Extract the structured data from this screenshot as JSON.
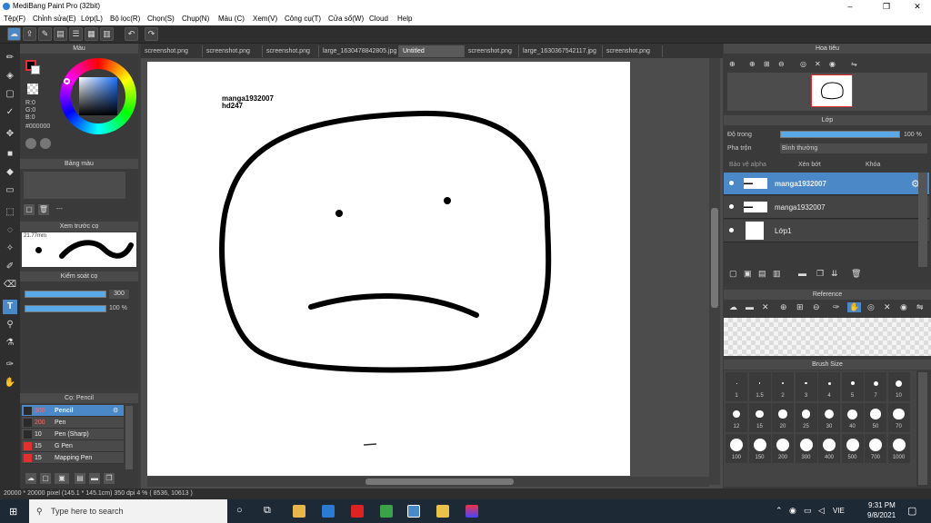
{
  "window": {
    "title": "MediBang Paint Pro (32bit)",
    "minimize": "–",
    "maximize": "❐",
    "close": "✕"
  },
  "menu": [
    "Tệp(F)",
    "Chỉnh sửa(E)",
    "Lớp(L)",
    "Bộ lọc(R)",
    "Chọn(S)",
    "Chụp(N)",
    "Màu (C)",
    "Xem(V)",
    "Công cụ(T)",
    "Cửa sổ(W)",
    "Cloud",
    "Help"
  ],
  "tabs": [
    "screenshot.png",
    "screenshot.png",
    "screenshot.png",
    "large_1630478842805.jpg",
    "Untitled",
    "screenshot.png",
    "large_1630367542117.jpg",
    "screenshot.png"
  ],
  "color_panel": {
    "title": "Màu",
    "r": "R:0",
    "g": "G:0",
    "b": "B:0",
    "hex": "#000000"
  },
  "palette_panel": {
    "title": "Bảng màu",
    "dash": "---"
  },
  "brush_preview": {
    "title": "Xem trước cọ",
    "size": "21.77mm"
  },
  "brush_control": {
    "title": "Kiểm soát cọ",
    "size": "300",
    "opacity": "100 %"
  },
  "brush_list": {
    "title": "Cọ: Pencil",
    "items": [
      {
        "size": "300",
        "name": "Pencil",
        "color": "#2a2a2a"
      },
      {
        "size": "200",
        "name": "Pen",
        "color": "#2a2a2a"
      },
      {
        "size": "10",
        "name": "Pen (Sharp)",
        "color": "#2a2a2a"
      },
      {
        "size": "15",
        "name": "G Pen",
        "color": "#e03030"
      },
      {
        "size": "15",
        "name": "Mapping Pen",
        "color": "#e03030"
      }
    ]
  },
  "navigator": {
    "title": "Hoa tiêu"
  },
  "layer_panel": {
    "title": "Lớp",
    "opacity_label": "Độ trong",
    "opacity_value": "100 %",
    "blend_label": "Pha trộn",
    "blend_value": "Bình thường",
    "protect_alpha": "Bảo vệ alpha",
    "clipping": "Xén bớt",
    "lock": "Khóa",
    "layers": [
      "manga1932007",
      "manga1932007",
      "Lớp1"
    ]
  },
  "reference_panel": {
    "title": "Reference"
  },
  "brush_size_panel": {
    "title": "Brush Size",
    "sizes": [
      "1",
      "1.5",
      "2",
      "3",
      "4",
      "5",
      "7",
      "10",
      "12",
      "15",
      "20",
      "25",
      "30",
      "40",
      "50",
      "70",
      "100",
      "150",
      "200",
      "300",
      "400",
      "500",
      "700",
      "1000"
    ]
  },
  "canvas_text": {
    "line1": "manga1932007",
    "line2": "hd247"
  },
  "status": "20000 * 20000 pixel  (145.1 * 145.1cm)  350 dpi  4 %  ( 8536, 10613 )",
  "taskbar": {
    "search_placeholder": "Type here to search",
    "time": "9:31 PM",
    "date": "9/8/2021",
    "lang": "VIE"
  }
}
